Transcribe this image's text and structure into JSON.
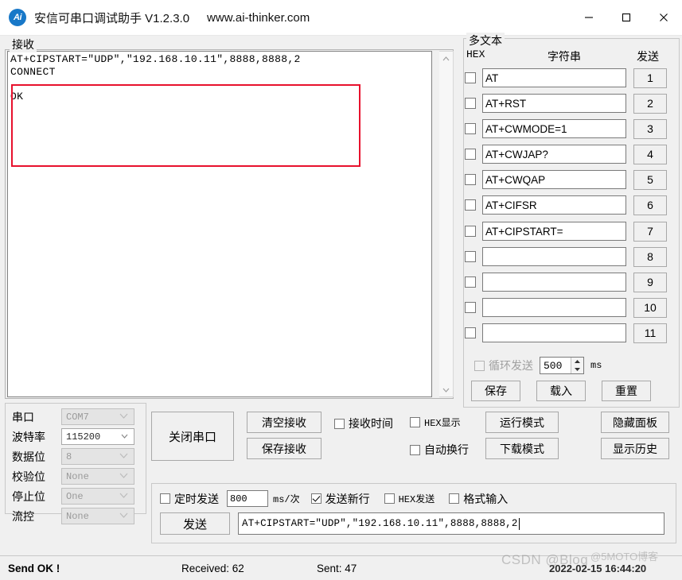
{
  "window": {
    "title": "安信可串口调试助手 V1.2.3.0",
    "url": "www.ai-thinker.com",
    "icon_text": "Ai",
    "minimize_label": "—",
    "maximize_label": "□",
    "close_label": "✕"
  },
  "receive": {
    "group_label": "接收",
    "text": "AT+CIPSTART=\"UDP\",\"192.168.10.11\",8888,8888,2\nCONNECT\n\nOK",
    "scroll_up": "⌃",
    "scroll_down": "⌄",
    "highlight_color": "#e8112d"
  },
  "serial": {
    "rows": [
      {
        "label": "串口",
        "value": "COM7",
        "enabled": false
      },
      {
        "label": "波特率",
        "value": "115200",
        "enabled": true
      },
      {
        "label": "数据位",
        "value": "8",
        "enabled": false
      },
      {
        "label": "校验位",
        "value": "None",
        "enabled": false
      },
      {
        "label": "停止位",
        "value": "One",
        "enabled": false
      },
      {
        "label": "流控",
        "value": "None",
        "enabled": false
      }
    ],
    "caret": "⌄"
  },
  "controls": {
    "close_port": "关闭串口",
    "clear_receive": "清空接收",
    "save_receive": "保存接收",
    "recv_time_label": "接收时间",
    "recv_time_checked": false,
    "hex_display_label": "HEX显示",
    "hex_display_checked": false,
    "auto_wrap_label": "自动换行",
    "auto_wrap_checked": false,
    "run_mode": "运行模式",
    "download_mode": "下载模式",
    "hide_panel": "隐藏面板",
    "show_history": "显示历史"
  },
  "send": {
    "timed_send_label": "定时发送",
    "timed_send_checked": false,
    "interval_value": "800",
    "interval_unit": "ms/次",
    "newline_label": "发送新行",
    "newline_checked": true,
    "hex_send_label": "HEX发送",
    "hex_send_checked": false,
    "format_input_label": "格式输入",
    "format_input_checked": false,
    "send_button": "发送",
    "input_value": "AT+CIPSTART=\"UDP\",\"192.168.10.11\",8888,8888,2"
  },
  "multitext": {
    "group_label": "多文本",
    "col_hex": "HEX",
    "col_string": "字符串",
    "col_send": "发送",
    "rows": [
      {
        "checked": false,
        "value": "AT",
        "button": "1"
      },
      {
        "checked": false,
        "value": "AT+RST",
        "button": "2"
      },
      {
        "checked": false,
        "value": "AT+CWMODE=1",
        "button": "3"
      },
      {
        "checked": false,
        "value": "AT+CWJAP?",
        "button": "4"
      },
      {
        "checked": false,
        "value": "AT+CWQAP",
        "button": "5"
      },
      {
        "checked": false,
        "value": "AT+CIFSR",
        "button": "6"
      },
      {
        "checked": false,
        "value": "AT+CIPSTART=",
        "button": "7"
      },
      {
        "checked": false,
        "value": "",
        "button": "8"
      },
      {
        "checked": false,
        "value": "",
        "button": "9"
      },
      {
        "checked": false,
        "value": "",
        "button": "10"
      },
      {
        "checked": false,
        "value": "",
        "button": "11"
      }
    ],
    "loop_send_label": "循环发送",
    "loop_send_checked": false,
    "loop_send_enabled": false,
    "loop_interval": "500",
    "loop_unit": "ms",
    "spin_up": "▲",
    "spin_down": "▼",
    "save_button": "保存",
    "load_button": "载入",
    "reset_button": "重置"
  },
  "status": {
    "send_status": "Send OK !",
    "received": "Received: 62",
    "sent": "Sent: 47",
    "timestamp": "2022-02-15 16:44:20",
    "watermark": "CSDN @Blog",
    "watermark2": "@5MOTO博客"
  }
}
